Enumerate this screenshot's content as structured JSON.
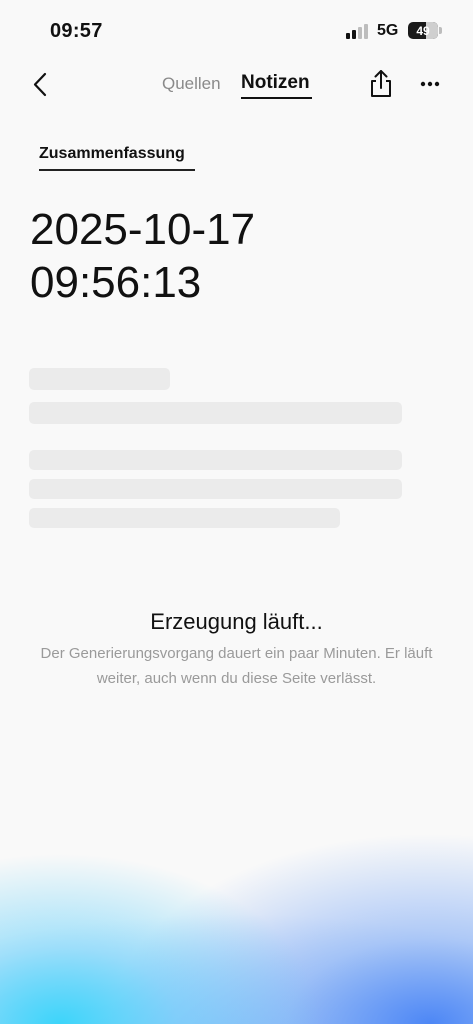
{
  "status_bar": {
    "time": "09:57",
    "network": "5G",
    "battery": "49"
  },
  "nav": {
    "tabs": [
      {
        "label": "Quellen",
        "active": false
      },
      {
        "label": "Notizen",
        "active": true
      }
    ]
  },
  "content": {
    "section_label": "Zusammenfassung",
    "date": "2025-10-17",
    "time": "09:56:13"
  },
  "progress": {
    "title": "Erzeugung läuft...",
    "description": "Der Generierungsvorgang dauert ein paar Minuten. Er läuft weiter, auch wenn du diese Seite verlässt."
  },
  "icons": {
    "back": "chevron-left-icon",
    "share": "share-icon",
    "more": "ellipsis-icon",
    "signal": "signal-icon"
  },
  "colors": {
    "background": "#f9f9f9",
    "skeleton": "#ebebeb",
    "secondary_text": "#9a9a9a",
    "glow_cyan": "#35d4fa",
    "glow_blue": "#4682f5"
  }
}
